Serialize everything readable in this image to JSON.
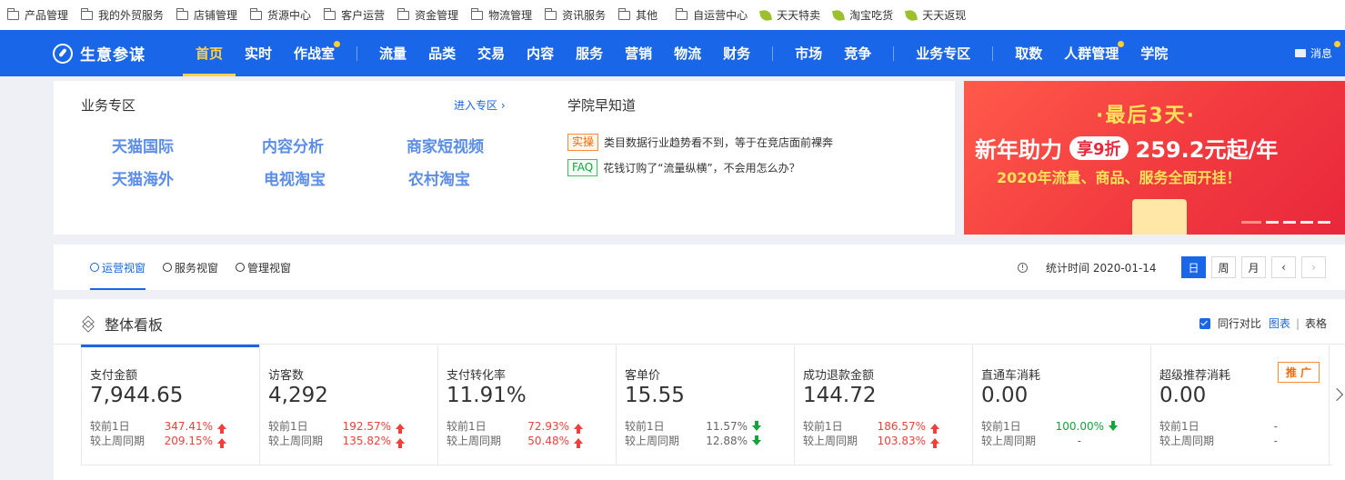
{
  "bookmarks": [
    {
      "label": "产品管理",
      "icon": "folder-icon"
    },
    {
      "label": "我的外贸服务",
      "icon": "folder-icon"
    },
    {
      "label": "店铺管理",
      "icon": "folder-icon"
    },
    {
      "label": "货源中心",
      "icon": "folder-icon"
    },
    {
      "label": "客户运营",
      "icon": "folder-icon"
    },
    {
      "label": "资金管理",
      "icon": "folder-icon"
    },
    {
      "label": "物流管理",
      "icon": "folder-icon"
    },
    {
      "label": "资讯服务",
      "icon": "folder-icon"
    },
    {
      "label": "其他",
      "icon": "folder-icon"
    },
    {
      "label": "自运营中心",
      "icon": "folder-icon"
    },
    {
      "label": "天天特卖",
      "icon": "leaf-icon"
    },
    {
      "label": "淘宝吃货",
      "icon": "leaf-icon"
    },
    {
      "label": "天天返现",
      "icon": "leaf-icon"
    }
  ],
  "nav": {
    "brand": "生意参谋",
    "items": [
      "首页",
      "实时",
      "作战室",
      "流量",
      "品类",
      "交易",
      "内容",
      "服务",
      "营销",
      "物流",
      "财务",
      "市场",
      "竞争",
      "业务专区",
      "取数",
      "人群管理",
      "学院"
    ],
    "message": "消息",
    "colors": {
      "bar": "#1a66e8",
      "active": "#ffd24c",
      "dot": "#ffcf33"
    }
  },
  "zone": {
    "title": "业务专区",
    "enter": "进入专区 ›",
    "links": [
      "天猫国际",
      "内容分析",
      "商家短视频",
      "天猫海外",
      "电视淘宝",
      "农村淘宝"
    ]
  },
  "academy": {
    "title": "学院早知道",
    "items": [
      {
        "tag": "实操",
        "text": "类目数据行业趋势看不到，等于在竞店面前裸奔"
      },
      {
        "tag": "FAQ",
        "text": "花钱订购了“流量纵横”，不会用怎么办？"
      }
    ]
  },
  "banner": {
    "line1": "·最后3天·",
    "line2a": "新年助力",
    "line2pill": "享9折",
    "line2b": "259.2元起/年",
    "line3": "2020年流量、商品、服务全面开挂！"
  },
  "viewtabs": [
    "运营视窗",
    "服务视窗",
    "管理视窗"
  ],
  "stat": {
    "label": "统计时间 2020-01-14",
    "periods": [
      "日",
      "周",
      "月"
    ],
    "prev": "‹",
    "next": "›"
  },
  "dashboard": {
    "title": "整体看板",
    "compare": "同行对比",
    "chart_link": "图表",
    "table_link": "表格",
    "row1_label": "较前1日",
    "row2_label": "较上周同期",
    "promo": "推 广",
    "metrics": [
      {
        "label": "支付金额",
        "value": "7,944.65",
        "d1": "347.41%",
        "d1_dir": "up",
        "w1": "209.15%",
        "w1_dir": "up"
      },
      {
        "label": "访客数",
        "value": "4,292",
        "d1": "192.57%",
        "d1_dir": "up",
        "w1": "135.82%",
        "w1_dir": "up"
      },
      {
        "label": "支付转化率",
        "value": "11.91%",
        "d1": "72.93%",
        "d1_dir": "up",
        "w1": "50.48%",
        "w1_dir": "up"
      },
      {
        "label": "客单价",
        "value": "15.55",
        "d1": "11.57%",
        "d1_dir": "down",
        "w1": "12.88%",
        "w1_dir": "down"
      },
      {
        "label": "成功退款金额",
        "value": "144.72",
        "d1": "186.57%",
        "d1_dir": "up",
        "w1": "103.83%",
        "w1_dir": "up"
      },
      {
        "label": "直通车消耗",
        "value": "0.00",
        "d1": "100.00%",
        "d1_dir": "down-green",
        "w1": "-",
        "w1_dir": "none"
      },
      {
        "label": "超级推荐消耗",
        "value": "0.00",
        "d1": "-",
        "d1_dir": "none",
        "w1": "-",
        "w1_dir": "none"
      }
    ]
  }
}
